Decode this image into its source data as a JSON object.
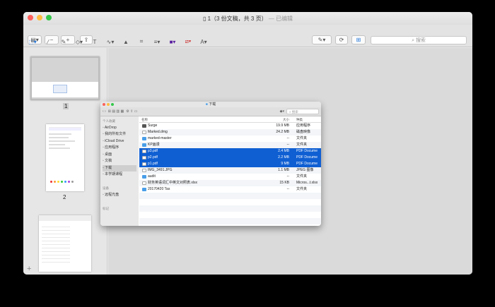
{
  "window": {
    "title": "1（3 份文稿，共 3 页）",
    "title_edited": "— 已编辑",
    "search_placeholder": "搜索"
  },
  "colors": {
    "accent": "#0f5fd3",
    "folder": "#4a9ee8"
  },
  "markup_tools": [
    "select-rect-icon",
    "magic-wand-icon",
    "shapes-icon",
    "text-icon",
    "sign-icon",
    "adjust-color-icon",
    "crop-icon",
    "line-style-icon",
    "border-color-icon",
    "fill-color-icon",
    "text-style-icon"
  ],
  "pages": [
    {
      "number": "1"
    },
    {
      "number": "2"
    },
    {
      "number": ""
    }
  ],
  "finder": {
    "title": "下载",
    "search_placeholder": "搜索",
    "sidebar": [
      {
        "label": "个人收藏",
        "header": true
      },
      {
        "label": "AirDrop"
      },
      {
        "label": "我的所有文件"
      },
      {
        "label": "iCloud Drive"
      },
      {
        "label": "应用程序"
      },
      {
        "label": "桌面"
      },
      {
        "label": "文稿"
      },
      {
        "label": "下载",
        "selected": true
      },
      {
        "label": "本学期课程"
      },
      {
        "label": "",
        "header": true
      },
      {
        "label": "设备",
        "header": true
      },
      {
        "label": "远程光盘"
      },
      {
        "label": "",
        "header": true
      },
      {
        "label": "标记",
        "header": true
      }
    ],
    "columns": {
      "name": "名称",
      "size": "大小",
      "kind": "种类"
    },
    "files": [
      {
        "name": "Surge",
        "size": "19.9 MB",
        "kind": "应用程序",
        "type": "app"
      },
      {
        "name": "Marked.dmg",
        "size": "24.2 MB",
        "kind": "磁盘映像",
        "type": "doc"
      },
      {
        "name": "marked-master",
        "size": "--",
        "kind": "文件夹",
        "type": "folder"
      },
      {
        "name": "KP画漫",
        "size": "--",
        "kind": "文件夹",
        "type": "folder"
      },
      {
        "name": "p3.pdf",
        "size": "2.4 MB",
        "kind": "PDF Docume",
        "type": "doc",
        "selected": true
      },
      {
        "name": "p2.pdf",
        "size": "2.2 MB",
        "kind": "PDF Docume",
        "type": "doc",
        "selected": true
      },
      {
        "name": "p1.pdf",
        "size": "9 MB",
        "kind": "PDF Docume",
        "type": "doc",
        "selected": true
      },
      {
        "name": "IMG_3491.JPG",
        "size": "1.1 MB",
        "kind": "JPEG 图像",
        "type": "doc"
      },
      {
        "name": "audit",
        "size": "--",
        "kind": "文件夹",
        "type": "folder"
      },
      {
        "name": "财务英语词汇中英文对照表.xlsx",
        "size": "15 KB",
        "kind": "Micros...t.xlsx",
        "type": "doc"
      },
      {
        "name": "20170420 Tas",
        "size": "--",
        "kind": "文件夹",
        "type": "folder"
      }
    ]
  }
}
